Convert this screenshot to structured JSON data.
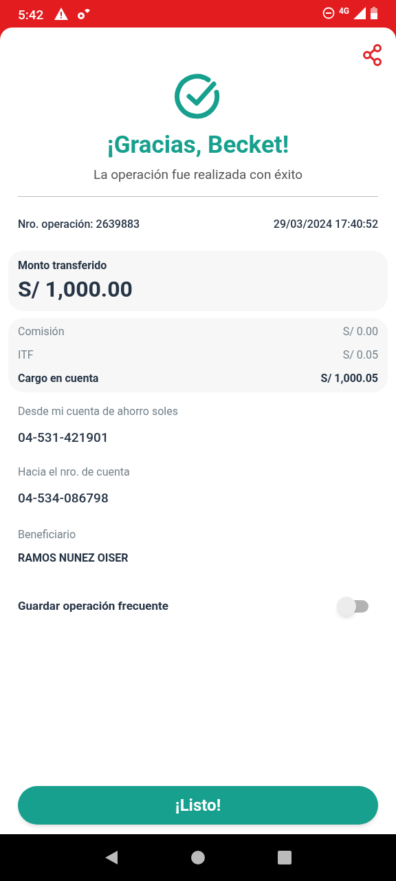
{
  "status_bar": {
    "time": "5:42",
    "network": "4G"
  },
  "title": "¡Gracias, Becket!",
  "subtitle": "La operación fue realizada con éxito",
  "operation": {
    "number": "Nro. operación: 2639883",
    "datetime": "29/03/2024 17:40:52"
  },
  "amount": {
    "label": "Monto transferido",
    "value": "S/ 1,000.00"
  },
  "charges": [
    {
      "label": "Comisión",
      "value": "S/ 0.00",
      "kind": "fee"
    },
    {
      "label": "ITF",
      "value": "S/ 0.05",
      "kind": "fee"
    },
    {
      "label": "Cargo en cuenta",
      "value": "S/ 1,000.05",
      "kind": "total"
    }
  ],
  "details": [
    {
      "label": "Desde mi cuenta de ahorro soles",
      "value": "04-531-421901",
      "kind": "account"
    },
    {
      "label": "Hacia el nro. de cuenta",
      "value": "04-534-086798",
      "kind": "account"
    },
    {
      "label": "Beneficiario",
      "value": "RAMOS NUNEZ OISER",
      "kind": "name"
    }
  ],
  "save_frequent": {
    "label": "Guardar operación frecuente",
    "on": false
  },
  "done_button": "¡Listo!"
}
